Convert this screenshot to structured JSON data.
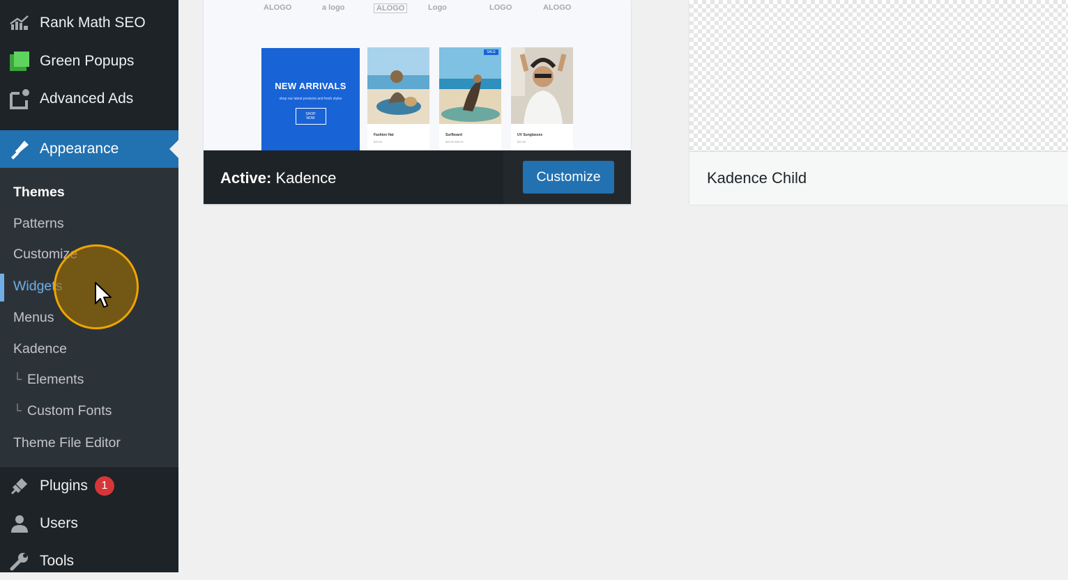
{
  "sidebar": {
    "top_items": [
      {
        "label": "Rank Math SEO",
        "icon": "rank-math-icon"
      },
      {
        "label": "Green Popups",
        "icon": "green-popups-icon"
      },
      {
        "label": "Advanced Ads",
        "icon": "advanced-ads-icon"
      }
    ],
    "appearance": {
      "label": "Appearance",
      "icon": "paintbrush-icon"
    },
    "submenu": [
      {
        "label": "Themes",
        "state": "current"
      },
      {
        "label": "Patterns"
      },
      {
        "label": "Customize"
      },
      {
        "label": "Widgets",
        "state": "focused"
      },
      {
        "label": "Menus"
      },
      {
        "label": "Kadence"
      },
      {
        "label": "Elements",
        "child": true
      },
      {
        "label": "Custom Fonts",
        "child": true
      },
      {
        "label": "Theme File Editor"
      }
    ],
    "bottom_items": [
      {
        "label": "Plugins",
        "icon": "plugins-icon",
        "badge": "1"
      },
      {
        "label": "Users",
        "icon": "users-icon"
      },
      {
        "label": "Tools",
        "icon": "wrench-icon"
      }
    ],
    "branch_glyph": "└"
  },
  "active_theme": {
    "prefix": "Active:",
    "name": "Kadence",
    "customize_label": "Customize",
    "screenshot": {
      "logos": [
        "ALOGO",
        "a logo",
        "ALOGO",
        "Logo",
        "LOGO",
        "ALOGO"
      ],
      "banner_title": "NEW ARRIVALS",
      "banner_subtitle": "shop our latest products and fresh styles",
      "banner_button": "SHOP NOW",
      "products": [
        {
          "name": "Fashion Hat",
          "price": "$39.00"
        },
        {
          "name": "Surfboard",
          "price": "$49.00 $39.00",
          "tag": "SALE"
        },
        {
          "name": "UV Sunglasses",
          "price": "$24.00"
        }
      ]
    }
  },
  "child_theme": {
    "name": "Kadence Child"
  },
  "colors": {
    "sidebar_bg": "#1d2327",
    "submenu_bg": "#2c3338",
    "accent": "#2271b1",
    "focus": "#72aee6",
    "badge": "#d63638",
    "highlight": "#f0a500"
  }
}
